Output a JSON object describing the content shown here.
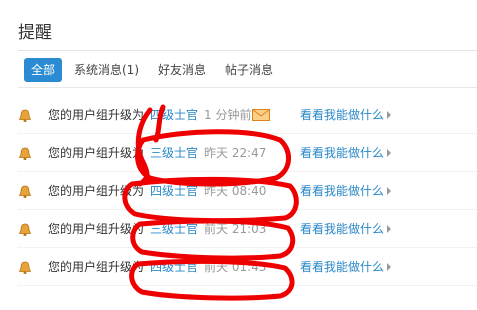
{
  "page": {
    "title": "提醒"
  },
  "tabs": [
    {
      "label": "全部",
      "active": true
    },
    {
      "label": "系统消息(1)",
      "active": false
    },
    {
      "label": "好友消息",
      "active": false
    },
    {
      "label": "帖子消息",
      "active": false
    }
  ],
  "notifications": [
    {
      "text": "您的用户组升级为",
      "rank": "四级士官",
      "time": "1 分钟前",
      "unread_mail": true,
      "action": "看看我能做什么"
    },
    {
      "text": "您的用户组升级为",
      "rank": "三级士官",
      "time": "昨天 22:47",
      "unread_mail": false,
      "action": "看看我能做什么"
    },
    {
      "text": "您的用户组升级为",
      "rank": "四级士官",
      "time": "昨天 08:40",
      "unread_mail": false,
      "action": "看看我能做什么"
    },
    {
      "text": "您的用户组升级为",
      "rank": "三级士官",
      "time": "前天 21:03",
      "unread_mail": false,
      "action": "看看我能做什么"
    },
    {
      "text": "您的用户组升级为",
      "rank": "四级士官",
      "time": "前天 01:43",
      "unread_mail": false,
      "action": "看看我能做什么"
    }
  ],
  "colors": {
    "tab_active_bg": "#2b8bd2",
    "link": "#2a88c8",
    "annotation": "#ee0000",
    "bell": "#e8a23a",
    "mail": "#f19a27"
  },
  "icons": {
    "bell": "bell-icon",
    "mail": "mail-icon",
    "arrow": "chevron-right-icon"
  },
  "annotation": "hand-drawn red circles around rank and time"
}
